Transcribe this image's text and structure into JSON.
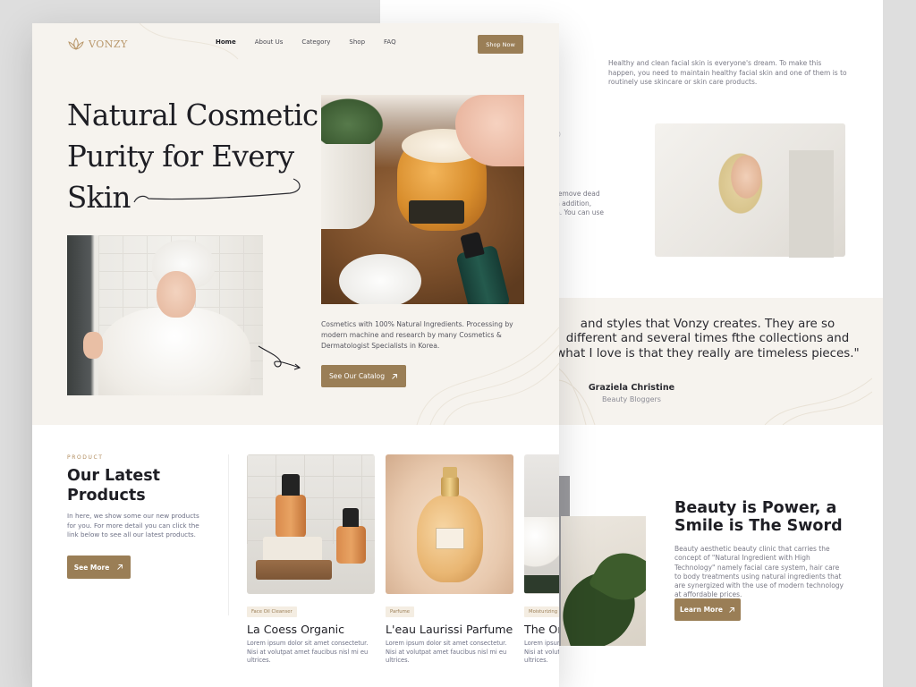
{
  "back_page": {
    "intro_text": "Healthy and clean facial skin is everyone's dream. To make this happen, you need to maintain healthy facial skin and one of them is to routinely use skincare or skin care products.",
    "fragment_text": "remove dead\nn addition,\nn. You can use a",
    "fragment_faded": "O",
    "testimonial": {
      "quote": "and styles that Vonzy creates. They are so different and several times fthe collections and what I love is that they really are timeless pieces.\"",
      "name": "Graziela Christine",
      "role": "Beauty Bloggers"
    },
    "feature": {
      "title": "Beauty is Power, a Smile is The Sword",
      "text": "Beauty aesthetic beauty clinic that carries the concept of \"Natural Ingredient with High Technology\" namely facial care system, hair care to body treatments using natural ingredients that are synergized with the use of modern technology at affordable prices.",
      "button_label": "Learn More"
    }
  },
  "nav": {
    "logo_text": "VONZY",
    "links": [
      "Home",
      "About Us",
      "Category",
      "Shop",
      "FAQ"
    ],
    "active_link": "Home",
    "cta_label": "Shop Now"
  },
  "hero": {
    "title_lines": [
      "Natural Cosmetic",
      "Purity for Every",
      "Skin"
    ],
    "description": "Cosmetics with 100% Natural Ingredients. Processing by modern machine and research by many Cosmetics & Dermatologist Specialists in Korea.",
    "cta_label": "See Our Catalog"
  },
  "products_section": {
    "eyebrow": "PRODUCT",
    "title": "Our Latest Products",
    "text": "In here, we show some our new products for you. For more detail you can click the link below to see all our latest products.",
    "button_label": "See More",
    "items": [
      {
        "tag": "Face Oil Cleanser",
        "name": "La Coess Organic",
        "desc": "Lorem ipsum dolor sit amet consectetur. Nisi at volutpat amet faucibus nisl mi eu ultrices."
      },
      {
        "tag": "Parfume",
        "name": "L'eau Laurissi Parfume",
        "desc": "Lorem ipsum dolor sit amet consectetur. Nisi at volutpat amet faucibus nisl mi eu ultrices."
      },
      {
        "tag": "Moisturizing",
        "name": "The Or",
        "desc": "Lorem ipsum dolor sit amet consectetur. Nisi at volutpat amet faucibus nisl mi eu ultrices."
      }
    ]
  },
  "colors": {
    "accent": "#9a7e56",
    "cream_background": "#f6f3ee",
    "heading_text": "#1e1e24",
    "body_text": "#6d7085"
  },
  "icons": {
    "arrow": "arrow-up-right-icon",
    "logo": "lotus-logo-icon"
  }
}
